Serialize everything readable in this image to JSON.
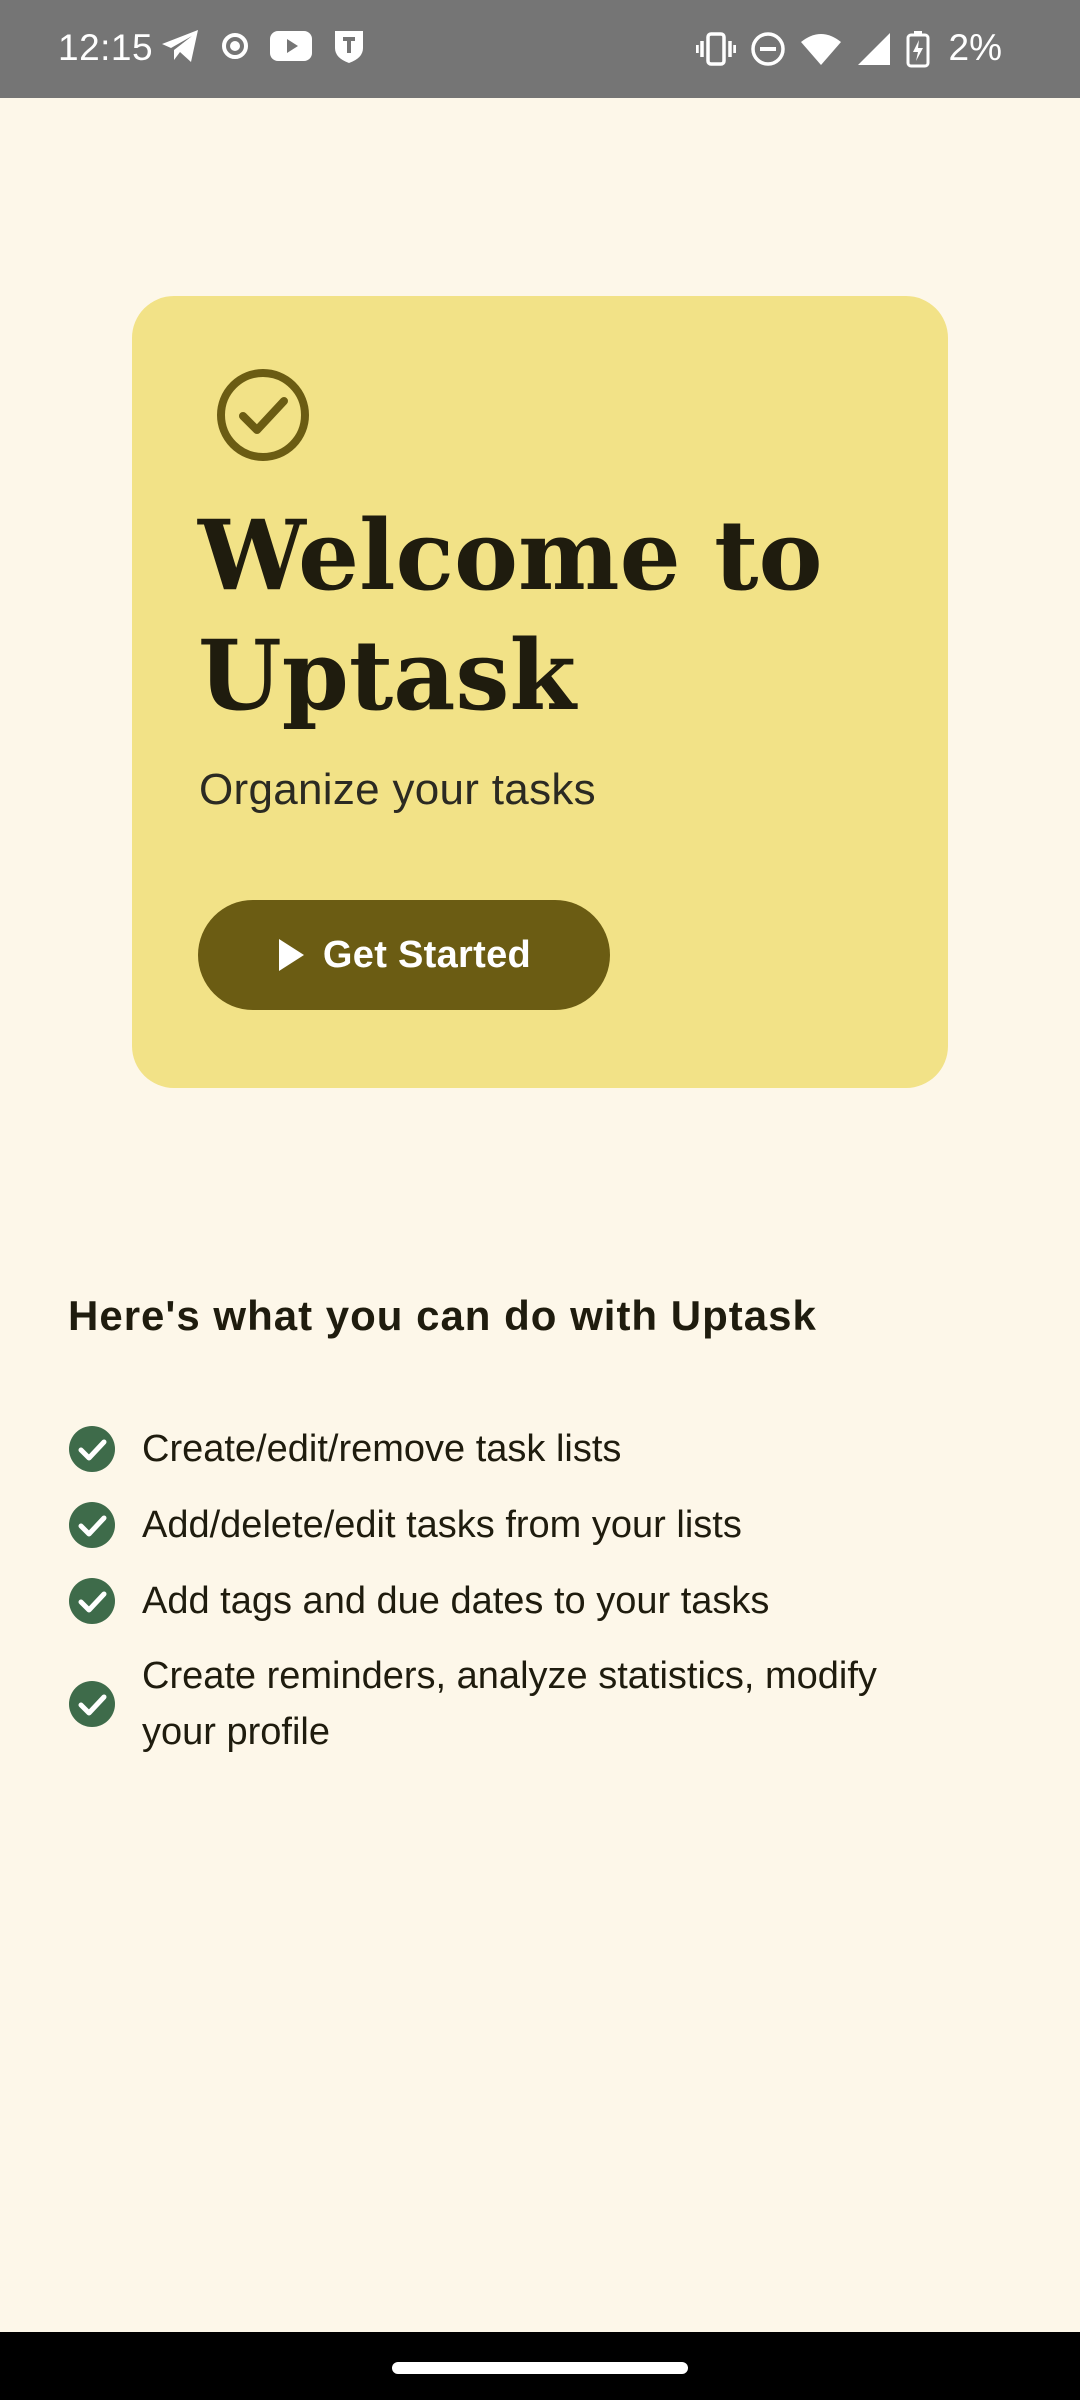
{
  "status_bar": {
    "time": "12:15",
    "battery_percent": "2%",
    "left_icons": [
      "telegram-icon",
      "record-icon",
      "youtube-icon",
      "shield-t-icon"
    ],
    "right_icons": [
      "vibrate-icon",
      "do-not-disturb-icon",
      "wifi-icon",
      "signal-icon",
      "battery-charging-icon"
    ]
  },
  "hero": {
    "icon": "check-circle-icon",
    "title": "Welcome to Uptask",
    "subtitle": "Organize your tasks",
    "cta_label": "Get Started",
    "cta_icon": "play-icon"
  },
  "features": {
    "heading": "Here's what you can do with Uptask",
    "items": [
      "Create/edit/remove task lists",
      "Add/delete/edit tasks from your lists",
      "Add tags and due dates to your tasks",
      "Create reminders, analyze statistics, modify your profile"
    ]
  },
  "colors": {
    "background": "#FDF7E9",
    "card": "#F2E287",
    "accent": "#6B5C13",
    "check_green": "#3E6B4A",
    "status_bar": "#757575"
  }
}
